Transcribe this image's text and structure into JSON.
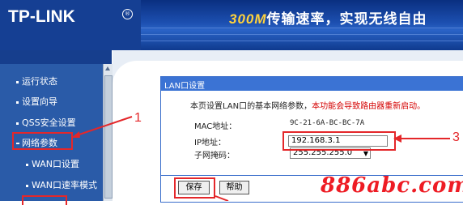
{
  "header": {
    "logo": "TP-LINK",
    "registered_mark": "®",
    "slogan_number": "300M",
    "slogan_text": "传输速率，实现无线自由"
  },
  "sidebar": {
    "items": [
      {
        "label": "运行状态"
      },
      {
        "label": "设置向导"
      },
      {
        "label": "QSS安全设置"
      },
      {
        "label": "网络参数"
      },
      {
        "label": "WAN口设置"
      },
      {
        "label": "WAN口速率模式"
      }
    ]
  },
  "panel": {
    "title": "LAN口设置",
    "description": "本页设置LAN口的基本网络参数，",
    "warning": "本功能会导致路由器重新启动。",
    "mac_label": "MAC地址：",
    "mac_value": "9C-21-6A-BC-BC-7A",
    "ip_label": "IP地址：",
    "ip_value": "192.168.3.1",
    "mask_label": "子网掩码：",
    "mask_value": "255.255.255.0",
    "save_label": "保存",
    "help_label": "帮助"
  },
  "annotations": {
    "step1": "1",
    "step3": "3"
  },
  "watermark": "886abc.com",
  "colors": {
    "header_bg": "#153f93",
    "sidebar_bg": "#2a5ba8",
    "panel_title_bg": "#3b73d4",
    "annotation_red": "#e4272a",
    "warning_red": "#d40000"
  }
}
